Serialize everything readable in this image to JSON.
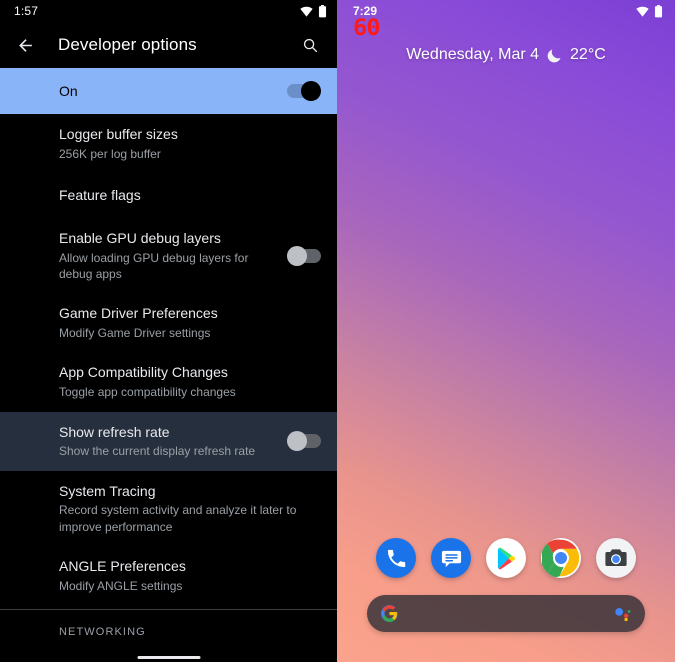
{
  "left_panel": {
    "status_bar": {
      "clock": "1:57",
      "icons": [
        "wifi-icon",
        "battery-icon"
      ]
    },
    "toolbar": {
      "back_icon": "arrow-back-icon",
      "title": "Developer options",
      "search_icon": "search-icon"
    },
    "master_switch": {
      "label": "On",
      "state": "on"
    },
    "items": [
      {
        "title": "Logger buffer sizes",
        "summary": "256K per log buffer",
        "toggle": null
      },
      {
        "title": "Feature flags",
        "summary": "",
        "toggle": null
      },
      {
        "title": "Enable GPU debug layers",
        "summary": "Allow loading GPU debug layers for debug apps",
        "toggle": "off"
      },
      {
        "title": "Game Driver Preferences",
        "summary": "Modify Game Driver settings",
        "toggle": null
      },
      {
        "title": "App Compatibility Changes",
        "summary": "Toggle app compatibility changes",
        "toggle": null
      },
      {
        "title": "Show refresh rate",
        "summary": "Show the current display refresh rate",
        "toggle": "off",
        "highlighted": true
      },
      {
        "title": "System Tracing",
        "summary": "Record system activity and analyze it later to improve performance",
        "toggle": null
      },
      {
        "title": "ANGLE Preferences",
        "summary": "Modify ANGLE settings",
        "toggle": null
      }
    ],
    "section_header": "NETWORKING",
    "colors": {
      "accent": "#8ab4f8",
      "highlight_row": "#262f3d",
      "background": "#000000"
    }
  },
  "right_panel": {
    "status_bar": {
      "clock": "7:29",
      "icons": [
        "wifi-icon",
        "battery-icon"
      ]
    },
    "refresh_rate_overlay": {
      "value": "60",
      "color": "#ff1a1a"
    },
    "date_widget": {
      "date": "Wednesday, Mar 4",
      "weather_icon": "crescent-moon-icon",
      "temperature": "22°C"
    },
    "dock": [
      {
        "name": "phone-app-icon",
        "label": "Phone"
      },
      {
        "name": "messages-app-icon",
        "label": "Messages"
      },
      {
        "name": "play-store-app-icon",
        "label": "Play Store"
      },
      {
        "name": "chrome-app-icon",
        "label": "Chrome"
      },
      {
        "name": "camera-app-icon",
        "label": "Camera"
      }
    ],
    "search_bar": {
      "google_logo": "google-g-icon",
      "assistant_icon": "google-assistant-icon",
      "value": ""
    },
    "wallpaper": {
      "from": "#7b3fd4",
      "to": "#fba38c"
    }
  }
}
